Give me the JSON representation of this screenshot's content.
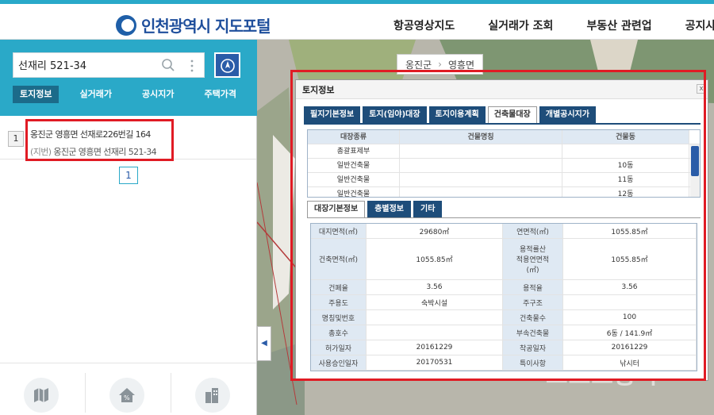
{
  "header": {
    "logo_text": "인천광역시 지도포털",
    "nav": [
      "항공영상지도",
      "실거래가 조회",
      "부동산 관련업",
      "공지사"
    ]
  },
  "sidebar": {
    "search": {
      "value": "선재리 521-34",
      "placeholder": ""
    },
    "tabs": [
      "토지정보",
      "실거래가",
      "공시지가",
      "주택가격"
    ],
    "active_tab": "토지정보",
    "results": [
      {
        "num": "1",
        "road": "옹진군 영흥면 선재로226번길 164",
        "jibun_label": "(지번)",
        "jibun": "옹진군 영흥면 선재리 521-34"
      }
    ],
    "page": "1"
  },
  "map": {
    "breadcrumb": [
      "옹진군",
      "영흥면"
    ],
    "collapse_glyph": "◀",
    "watermark": "스포츠동아"
  },
  "popup": {
    "title": "토지정보",
    "close": "x",
    "tabs": [
      "필지기본정보",
      "토지(임야)대장",
      "토지이용계획",
      "건축물대장",
      "개별공시지가"
    ],
    "active_tab": "건축물대장",
    "registry_table": {
      "headers": [
        "대장종류",
        "건물명칭",
        "건물동"
      ],
      "rows": [
        [
          "총괄표제부",
          "",
          ""
        ],
        [
          "일반건축물",
          "",
          "10동"
        ],
        [
          "일반건축물",
          "",
          "11동"
        ],
        [
          "일반건축물",
          "",
          "12동"
        ]
      ]
    },
    "sub_tabs": [
      "대장기본정보",
      "층별정보",
      "기타"
    ],
    "active_sub_tab": "대장기본정보",
    "details": [
      [
        "대지면적(㎡)",
        "29680㎡",
        "연면적(㎡)",
        "1055.85㎡"
      ],
      [
        "건축면적(㎡)",
        "1055.85㎡",
        "용적률산\n적용연면적\n(㎡)",
        "1055.85㎡"
      ],
      [
        "건폐율",
        "3.56",
        "용적율",
        "3.56"
      ],
      [
        "주용도",
        "숙박시설",
        "주구조",
        ""
      ],
      [
        "명칭및번호",
        "",
        "건축물수",
        "100"
      ],
      [
        "총호수",
        "",
        "부속건축물",
        "6동 / 141.9㎡"
      ],
      [
        "허가일자",
        "20161229",
        "착공일자",
        "20161229"
      ],
      [
        "사용승인일자",
        "20170531",
        "특이사항",
        "낚시터"
      ]
    ]
  },
  "colors": {
    "accent": "#2aa9c8",
    "navy": "#1e4d7a",
    "highlight": "#e01b24"
  }
}
